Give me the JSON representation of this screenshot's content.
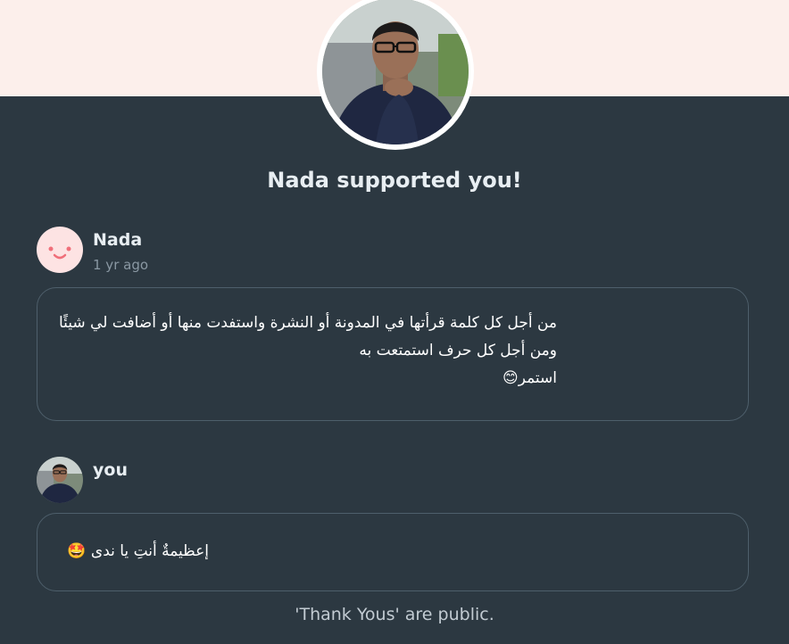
{
  "header": {
    "headline": "Nada supported you!"
  },
  "supporter": {
    "name": "Nada",
    "time": "1 yr ago",
    "message_lines": [
      "من أجل كل كلمة قرأتها في المدونة أو النشرة واستفدت منها أو أضافت لي شيئًا",
      "ومن أجل كل حرف استمتعت به",
      "استمر😊"
    ]
  },
  "reply": {
    "name": "you",
    "message": "إعظيمةٌ أنتِ يا ندى 🤩"
  },
  "footer": {
    "note": "'Thank Yous' are public."
  },
  "colors": {
    "top_band": "#fcefeb",
    "background": "#2c3841",
    "bubble_border": "#4e5f6b",
    "nada_avatar_bg": "#fde3e3",
    "nada_face": "#f06f7a"
  }
}
